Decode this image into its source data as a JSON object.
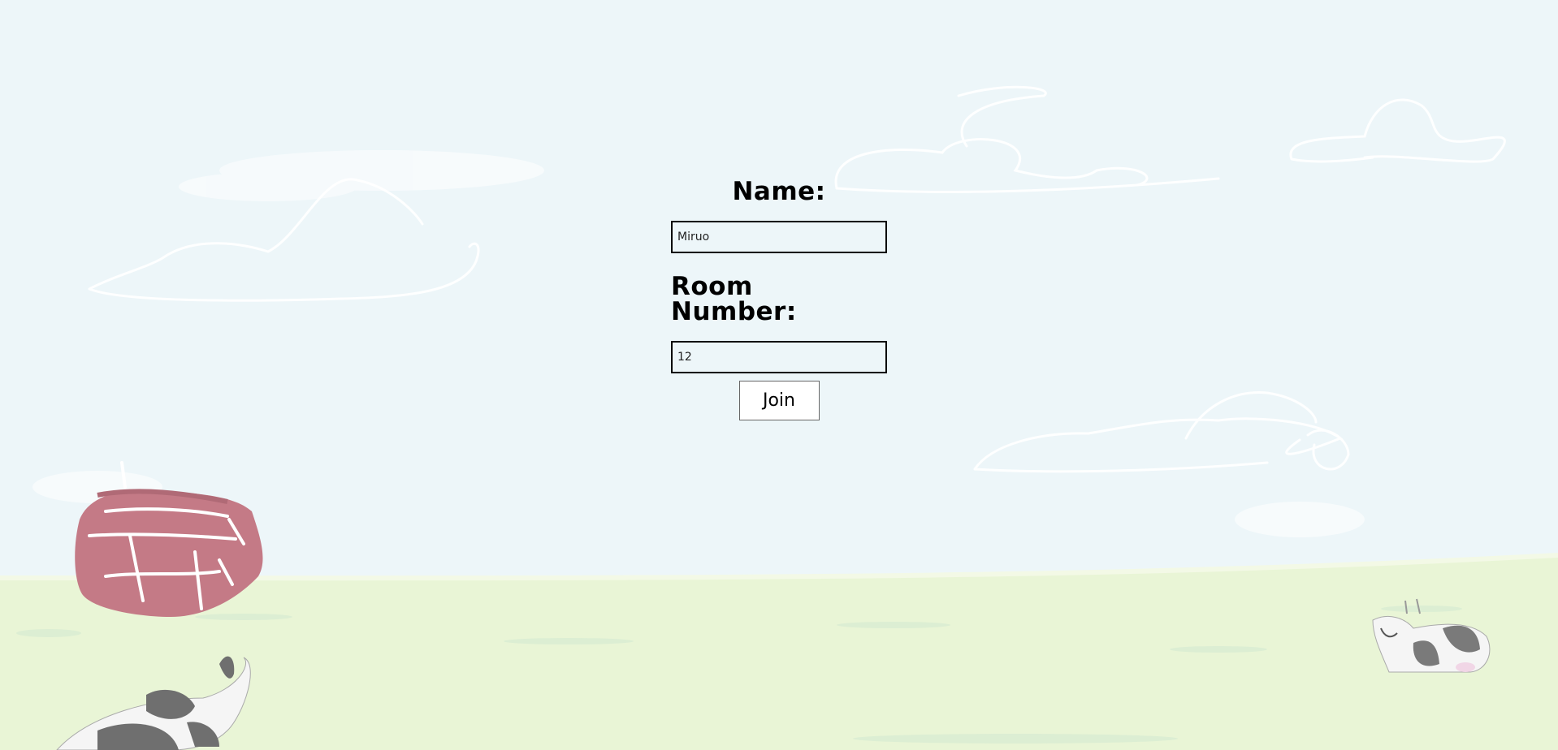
{
  "form": {
    "name_label": "Name:",
    "name_value": "Miruo",
    "room_label": "Room Number:",
    "room_value": "12",
    "join_label": "Join"
  },
  "colors": {
    "sky": "#edf6f9",
    "grass": "#e9f5d6",
    "barn": "#c47a86",
    "cow_spot": "#777777"
  }
}
